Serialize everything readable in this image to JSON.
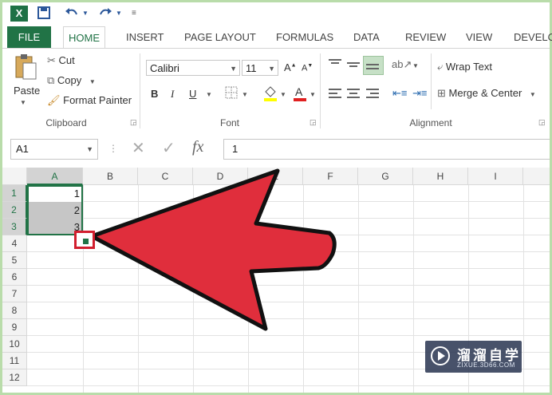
{
  "quick_access": {
    "app_icon": "X",
    "icons": [
      "save-icon",
      "undo-icon",
      "redo-icon",
      "customize-icon"
    ]
  },
  "tabs": [
    "FILE",
    "HOME",
    "INSERT",
    "PAGE LAYOUT",
    "FORMULAS",
    "DATA",
    "REVIEW",
    "VIEW",
    "DEVELO"
  ],
  "clipboard": {
    "paste": "Paste",
    "cut": "Cut",
    "copy": "Copy",
    "format_painter": "Format Painter",
    "group": "Clipboard"
  },
  "font": {
    "family": "Calibri",
    "size": "11",
    "bold": "B",
    "italic": "I",
    "underline": "U",
    "group": "Font",
    "fill_color": "#ffff00",
    "font_color": "#e02020"
  },
  "alignment": {
    "wrap_text": "Wrap Text",
    "merge_center": "Merge & Center",
    "group": "Alignment"
  },
  "formula_bar": {
    "name_box": "A1",
    "fx": "fx",
    "value": "1"
  },
  "sheet": {
    "columns": [
      "A",
      "B",
      "C",
      "D",
      "E",
      "F",
      "G",
      "H",
      "I"
    ],
    "rows": [
      "1",
      "2",
      "3",
      "4",
      "5",
      "6",
      "7",
      "8",
      "9",
      "10",
      "11",
      "12"
    ],
    "cells": {
      "A1": "1",
      "A2": "2",
      "A3": "3"
    }
  },
  "annotation": {
    "arrow_color": "#e02e3c"
  },
  "watermark": {
    "title": "溜溜自学",
    "url": "ZIXUE.3D66.COM"
  }
}
